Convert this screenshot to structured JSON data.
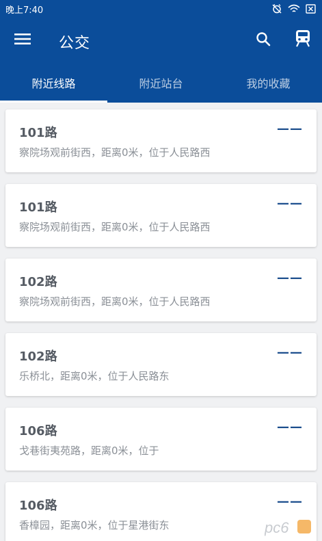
{
  "status_bar": {
    "time": "晚上7:40",
    "icons": [
      "alarm-off-icon",
      "wifi-icon",
      "battery-x-icon"
    ]
  },
  "toolbar": {
    "title": "公交",
    "menu_icon": "hamburger-menu-icon",
    "search_icon": "search-icon",
    "train_icon": "train-icon"
  },
  "tabs": [
    {
      "label": "附近线路",
      "active": true
    },
    {
      "label": "附近站台",
      "active": false
    },
    {
      "label": "我的收藏",
      "active": false
    }
  ],
  "routes": [
    {
      "name": "101路",
      "desc": "察院场观前街西，距离0米，位于人民路西",
      "status": "——"
    },
    {
      "name": "101路",
      "desc": "察院场观前街西，距离0米，位于人民路西",
      "status": "——"
    },
    {
      "name": "102路",
      "desc": "察院场观前街西，距离0米，位于人民路西",
      "status": "——"
    },
    {
      "name": "102路",
      "desc": "乐桥北，距离0米，位于人民路东",
      "status": "——"
    },
    {
      "name": "106路",
      "desc": "戈巷街夷苑路，距离0米，位于",
      "status": "——"
    },
    {
      "name": "106路",
      "desc": "香樟园，距离0米，位于星港街东",
      "status": "——"
    }
  ],
  "watermark": {
    "text": "pc6"
  },
  "colors": {
    "primary": "#0b4d9a",
    "background": "#f0f1f3",
    "route_title": "#555b63",
    "route_desc": "#8a8f96",
    "dash": "#1d4f8e"
  }
}
